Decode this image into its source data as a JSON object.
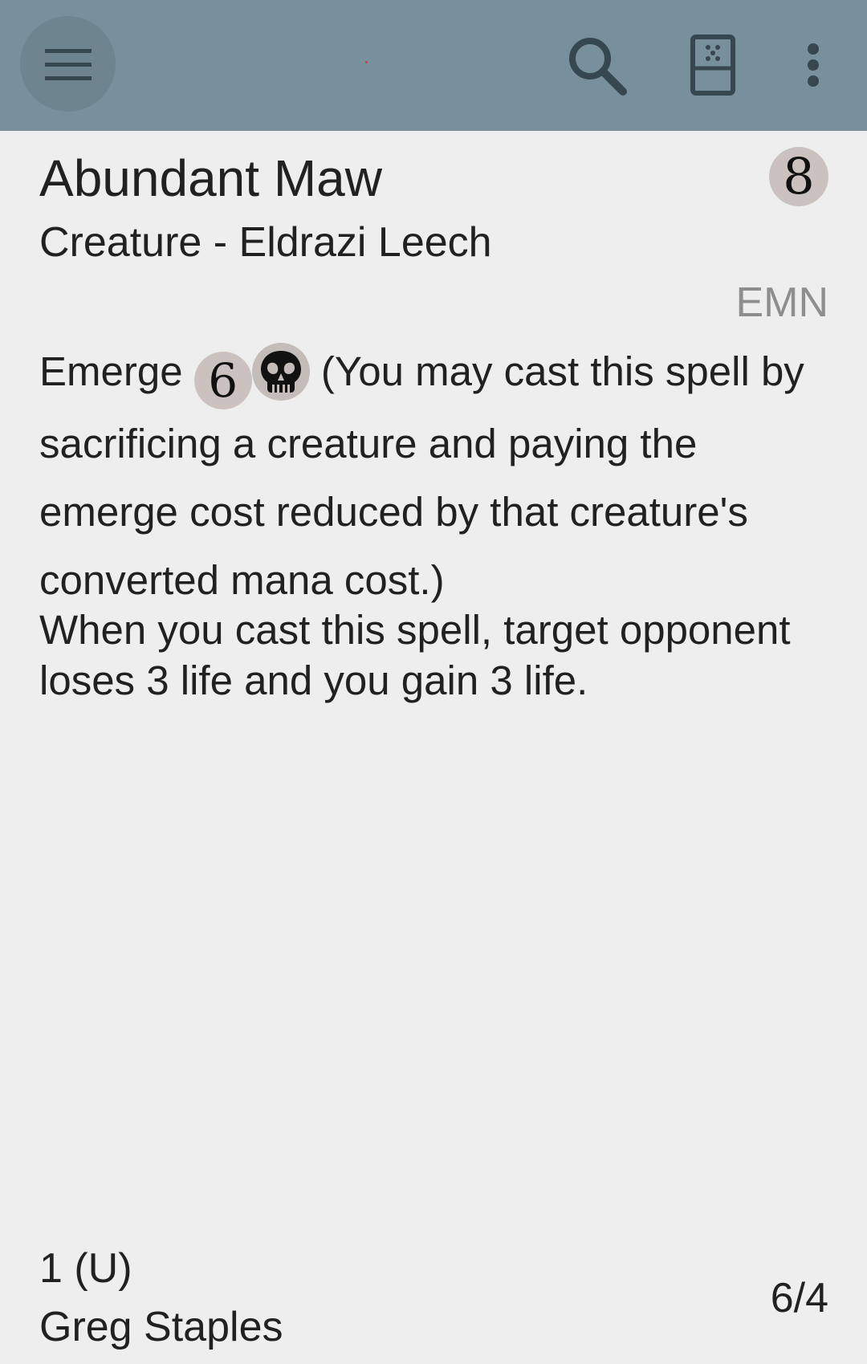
{
  "appbar": {
    "menu_icon": "hamburger-menu-icon",
    "search_icon": "search-icon",
    "random_icon": "random-card-icon",
    "more_icon": "more-vertical-icon",
    "background_color": "#78909c"
  },
  "card": {
    "name": "Abundant Maw",
    "mana_cost": "8",
    "type_line": "Creature - Eldrazi Leech",
    "set_code": "EMN",
    "rules": {
      "emerge_word": "Emerge",
      "emerge_generic_cost": "6",
      "emerge_black_symbol": "black-mana-skull-icon",
      "reminder_text": "(You may cast this spell by sacrificing a creature and paying the emerge cost reduced by that creature's converted mana cost.)",
      "ability_text": "When you cast this spell, target opponent loses 3 life and you gain 3 life."
    },
    "rarity": "1 (U)",
    "artist": "Greg Staples",
    "power_toughness": "6/4"
  },
  "colors": {
    "mana_symbol_bg": "#cbc2bf",
    "set_code_text": "#8e8e8e",
    "page_background": "#eeeeee"
  }
}
